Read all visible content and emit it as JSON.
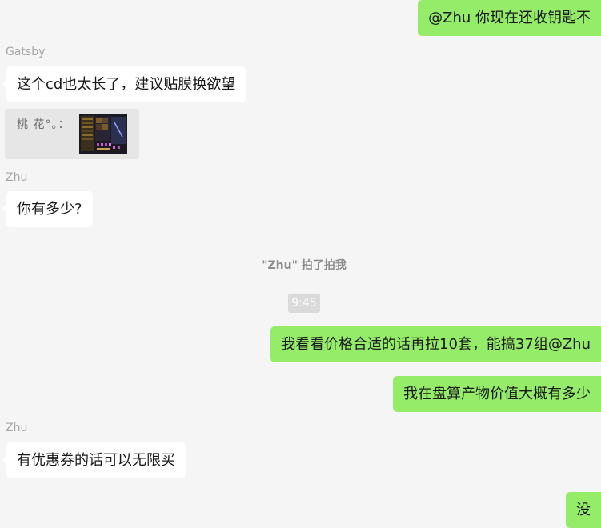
{
  "messages": [
    {
      "side": "out",
      "text": "@Zhu 你现在还收钥匙不"
    },
    {
      "sender": "Gatsby",
      "side": "in",
      "text": "这个cd也太长了，建议贴膜换欲望"
    },
    {
      "quote": {
        "author": "桃 花°。："
      }
    },
    {
      "sender": "Zhu",
      "side": "in",
      "text": "你有多少?"
    },
    {
      "system": "\"Zhu\" 拍了拍我"
    },
    {
      "time": "9:45"
    },
    {
      "side": "out",
      "text": "我看看价格合适的话再拉10套，能搞37组@Zhu"
    },
    {
      "side": "out",
      "text": "我在盘算产物价值大概有多少"
    },
    {
      "sender": "Zhu",
      "side": "in",
      "text": "有优惠券的话可以无限买"
    },
    {
      "side": "out",
      "text": "没"
    }
  ],
  "colors": {
    "background": "#f5f5f5",
    "outgoing_bubble": "#95ec69",
    "incoming_bubble": "#ffffff",
    "sender_name": "#a6a6a6",
    "system_text": "#8c8c8c"
  }
}
